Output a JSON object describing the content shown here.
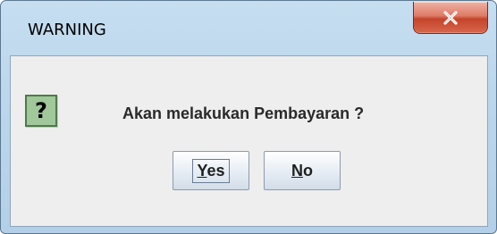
{
  "dialog": {
    "title": "WARNING",
    "message": "Akan melakukan Pembayaran ?",
    "icon": "question-icon",
    "buttons": {
      "yes": {
        "mnemonic": "Y",
        "rest": "es"
      },
      "no": {
        "mnemonic": "N",
        "rest": "o"
      }
    }
  },
  "colors": {
    "close_button": "#c4442b",
    "icon_background": "#a0c89a",
    "client_background": "#eeeeee"
  }
}
